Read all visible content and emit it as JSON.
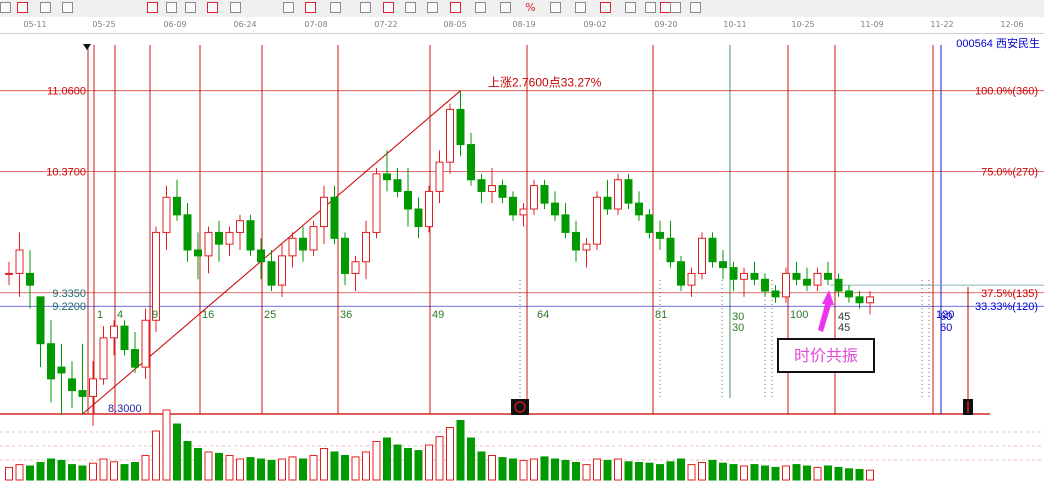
{
  "stock": {
    "code": "000564",
    "name": "西安民生"
  },
  "date_axis": [
    "05-11",
    "05-25",
    "06-09",
    "06-24",
    "07-08",
    "07-22",
    "08-05",
    "08-19",
    "09-02",
    "09-20",
    "10-11",
    "10-25",
    "11-09",
    "11-22",
    "12-06"
  ],
  "toolbar_icons": [
    "tool-1",
    "tool-2",
    "tool-3",
    "tool-4",
    "tool-5",
    "tool-6",
    "tool-7",
    "tool-8",
    "tool-9",
    "tool-10",
    "tool-11",
    "tool-12",
    "tool-13",
    "tool-14",
    "tool-15",
    "tool-16",
    "tool-17",
    "tool-18",
    "tool-19",
    "percent",
    "tool-21",
    "tool-22",
    "tool-23",
    "tool-24",
    "tool-25",
    "tool-26",
    "tool-27",
    "tool-28"
  ],
  "toolbar_percent": "%",
  "annotations": {
    "rise_text": "上涨2.7600点33.27%",
    "low_label": "8.3000",
    "callout": "时价共振"
  },
  "colors": {
    "up": "#e02020",
    "down": "#009900",
    "fib_red": "#c80000",
    "fib_blue": "#0000c8",
    "callout_text": "#e14bd8",
    "arrow": "#ee33ee",
    "price_red": "#cc0000"
  },
  "chart_data": {
    "type": "candlestick",
    "title": "",
    "ylim": [
      8.3,
      11.45
    ],
    "price_labels": [
      {
        "value": 11.06,
        "text": "11.0600"
      },
      {
        "value": 10.37,
        "text": "10.3700"
      },
      {
        "value": 9.335,
        "text": "9.3350"
      },
      {
        "value": 9.22,
        "text": "9.2200"
      }
    ],
    "fib_levels": [
      {
        "value": 11.06,
        "text": "100.0%(360)",
        "color": "red"
      },
      {
        "value": 10.37,
        "text": "75.0%(270)",
        "color": "red"
      },
      {
        "value": 9.335,
        "text": "37.5%(135)",
        "color": "red"
      },
      {
        "value": 9.22,
        "text": "33.33%(120)",
        "color": "blue"
      }
    ],
    "time_counts": [
      {
        "bar": 1,
        "text": "1"
      },
      {
        "bar": 4,
        "text": "4"
      },
      {
        "bar": 9,
        "text": "9"
      },
      {
        "bar": 16,
        "text": "16"
      },
      {
        "bar": 25,
        "text": "25"
      },
      {
        "bar": 36,
        "text": "36"
      },
      {
        "bar": 49,
        "text": "49"
      },
      {
        "bar": 64,
        "text": "64"
      },
      {
        "bar": 81,
        "text": "81"
      },
      {
        "bar": 100,
        "text": "100"
      }
    ],
    "time_pairs": [
      {
        "text": "30",
        "text2": "30"
      },
      {
        "text": "45",
        "text2": "45"
      },
      {
        "text": "60",
        "text2": "60"
      },
      {
        "text": "120",
        "text2": ""
      }
    ],
    "trend_line": {
      "from_price": 8.3,
      "to_price": 11.06
    },
    "candles": [
      [
        9.5,
        9.6,
        9.4,
        9.5
      ],
      [
        9.5,
        9.85,
        9.3,
        9.7
      ],
      [
        9.5,
        9.7,
        9.2,
        9.4
      ],
      [
        9.3,
        9.3,
        8.7,
        8.9
      ],
      [
        8.9,
        9.1,
        8.4,
        8.6
      ],
      [
        8.7,
        8.9,
        8.3,
        8.65
      ],
      [
        8.6,
        8.75,
        8.35,
        8.5
      ],
      [
        8.5,
        8.9,
        8.3,
        8.45
      ],
      [
        8.45,
        8.75,
        8.2,
        8.6
      ],
      [
        8.6,
        9.05,
        8.55,
        8.95
      ],
      [
        8.95,
        9.1,
        8.8,
        9.05
      ],
      [
        9.05,
        9.1,
        8.8,
        8.85
      ],
      [
        8.85,
        9.0,
        8.65,
        8.7
      ],
      [
        8.7,
        9.2,
        8.6,
        9.1
      ],
      [
        9.1,
        9.9,
        9.0,
        9.85
      ],
      [
        9.85,
        10.25,
        9.7,
        10.15
      ],
      [
        10.15,
        10.3,
        9.95,
        10.0
      ],
      [
        10.0,
        10.1,
        9.6,
        9.7
      ],
      [
        9.7,
        9.85,
        9.45,
        9.65
      ],
      [
        9.65,
        9.9,
        9.5,
        9.85
      ],
      [
        9.85,
        9.95,
        9.6,
        9.75
      ],
      [
        9.75,
        9.9,
        9.65,
        9.85
      ],
      [
        9.85,
        10.0,
        9.7,
        9.95
      ],
      [
        9.95,
        10.0,
        9.65,
        9.7
      ],
      [
        9.7,
        9.8,
        9.45,
        9.6
      ],
      [
        9.6,
        9.7,
        9.35,
        9.4
      ],
      [
        9.4,
        9.75,
        9.3,
        9.65
      ],
      [
        9.65,
        9.85,
        9.55,
        9.8
      ],
      [
        9.8,
        9.9,
        9.6,
        9.7
      ],
      [
        9.7,
        9.95,
        9.65,
        9.9
      ],
      [
        9.9,
        10.25,
        9.75,
        10.15
      ],
      [
        10.15,
        10.25,
        9.75,
        9.8
      ],
      [
        9.8,
        9.85,
        9.4,
        9.5
      ],
      [
        9.5,
        9.65,
        9.35,
        9.6
      ],
      [
        9.6,
        9.95,
        9.45,
        9.85
      ],
      [
        9.85,
        10.4,
        9.8,
        10.35
      ],
      [
        10.35,
        10.55,
        10.2,
        10.3
      ],
      [
        10.3,
        10.4,
        10.15,
        10.2
      ],
      [
        10.2,
        10.4,
        9.9,
        10.05
      ],
      [
        10.05,
        10.15,
        9.8,
        9.9
      ],
      [
        9.9,
        10.25,
        9.85,
        10.2
      ],
      [
        10.2,
        10.55,
        10.1,
        10.45
      ],
      [
        10.45,
        10.95,
        10.35,
        10.9
      ],
      [
        10.9,
        11.06,
        10.5,
        10.6
      ],
      [
        10.6,
        10.7,
        10.25,
        10.3
      ],
      [
        10.3,
        10.35,
        10.1,
        10.2
      ],
      [
        10.2,
        10.4,
        10.1,
        10.25
      ],
      [
        10.25,
        10.3,
        10.1,
        10.15
      ],
      [
        10.15,
        10.2,
        9.95,
        10.0
      ],
      [
        10.0,
        10.1,
        9.9,
        10.05
      ],
      [
        10.05,
        10.3,
        10.0,
        10.25
      ],
      [
        10.25,
        10.3,
        10.05,
        10.1
      ],
      [
        10.1,
        10.2,
        9.95,
        10.0
      ],
      [
        10.0,
        10.1,
        9.8,
        9.85
      ],
      [
        9.85,
        9.95,
        9.6,
        9.7
      ],
      [
        9.7,
        9.8,
        9.55,
        9.75
      ],
      [
        9.75,
        10.2,
        9.7,
        10.15
      ],
      [
        10.15,
        10.3,
        10.0,
        10.05
      ],
      [
        10.05,
        10.35,
        10.0,
        10.3
      ],
      [
        10.3,
        10.35,
        10.05,
        10.1
      ],
      [
        10.1,
        10.2,
        9.95,
        10.0
      ],
      [
        10.0,
        10.05,
        9.8,
        9.85
      ],
      [
        9.85,
        9.95,
        9.7,
        9.8
      ],
      [
        9.8,
        9.95,
        9.55,
        9.6
      ],
      [
        9.6,
        9.65,
        9.35,
        9.4
      ],
      [
        9.4,
        9.55,
        9.3,
        9.5
      ],
      [
        9.5,
        9.85,
        9.45,
        9.8
      ],
      [
        9.8,
        9.85,
        9.55,
        9.6
      ],
      [
        9.6,
        9.7,
        9.45,
        9.55
      ],
      [
        9.55,
        9.6,
        9.35,
        9.45
      ],
      [
        9.45,
        9.55,
        9.3,
        9.5
      ],
      [
        9.5,
        9.6,
        9.4,
        9.45
      ],
      [
        9.45,
        9.5,
        9.3,
        9.35
      ],
      [
        9.35,
        9.4,
        9.25,
        9.3
      ],
      [
        9.3,
        9.55,
        9.25,
        9.5
      ],
      [
        9.5,
        9.6,
        9.4,
        9.45
      ],
      [
        9.45,
        9.55,
        9.35,
        9.4
      ],
      [
        9.4,
        9.55,
        9.35,
        9.5
      ],
      [
        9.5,
        9.6,
        9.4,
        9.45
      ],
      [
        9.45,
        9.5,
        9.3,
        9.35
      ],
      [
        9.35,
        9.4,
        9.25,
        9.3
      ],
      [
        9.3,
        9.35,
        9.2,
        9.25
      ],
      [
        9.25,
        9.35,
        9.15,
        9.3
      ]
    ],
    "volume": [
      0.18,
      0.22,
      0.2,
      0.25,
      0.3,
      0.28,
      0.22,
      0.2,
      0.24,
      0.3,
      0.26,
      0.22,
      0.25,
      0.35,
      0.7,
      1.0,
      0.8,
      0.55,
      0.45,
      0.4,
      0.38,
      0.35,
      0.3,
      0.32,
      0.3,
      0.28,
      0.3,
      0.33,
      0.3,
      0.35,
      0.45,
      0.4,
      0.35,
      0.33,
      0.4,
      0.55,
      0.6,
      0.5,
      0.45,
      0.42,
      0.5,
      0.62,
      0.75,
      0.85,
      0.6,
      0.4,
      0.35,
      0.32,
      0.3,
      0.28,
      0.3,
      0.33,
      0.3,
      0.28,
      0.25,
      0.22,
      0.3,
      0.28,
      0.3,
      0.26,
      0.25,
      0.24,
      0.22,
      0.26,
      0.3,
      0.22,
      0.25,
      0.28,
      0.24,
      0.22,
      0.2,
      0.22,
      0.2,
      0.18,
      0.2,
      0.22,
      0.2,
      0.18,
      0.2,
      0.18,
      0.16,
      0.15,
      0.14
    ]
  }
}
